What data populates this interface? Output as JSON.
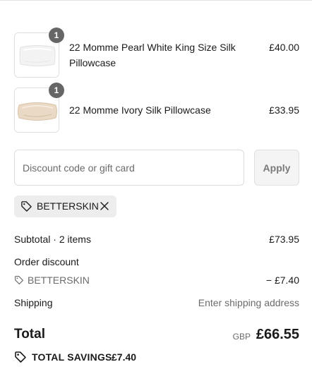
{
  "colors": {
    "text": "#1a1a1a",
    "muted": "#6b6b6b",
    "badge": "#666666",
    "chip_bg": "#ededed"
  },
  "line_items": [
    {
      "quantity": "1",
      "title": "22 Momme Pearl White King Size Silk Pillowcase",
      "price": "£40.00",
      "thumbnail_icon": "white-silk-pillowcase-image"
    },
    {
      "quantity": "1",
      "title": "22 Momme Ivory Silk Pillowcase",
      "price": "£33.95",
      "thumbnail_icon": "ivory-silk-pillowcase-image"
    }
  ],
  "discount": {
    "placeholder": "Discount code or gift card",
    "value": "",
    "apply_label": "Apply"
  },
  "applied_code": {
    "code": "BETTERSKIN",
    "tag_icon": "tag-icon",
    "remove_icon": "close-icon"
  },
  "summary": {
    "subtotal_label": "Subtotal · 2 items",
    "subtotal_value": "£73.95",
    "order_discount_label": "Order discount",
    "discount_code": "BETTERSKIN",
    "discount_value": "− £7.40",
    "shipping_label": "Shipping",
    "shipping_value": "Enter shipping address",
    "total_label": "Total",
    "currency": "GBP",
    "total_value": "£66.55",
    "savings_label": "TOTAL SAVINGS",
    "savings_value": "£7.40"
  }
}
